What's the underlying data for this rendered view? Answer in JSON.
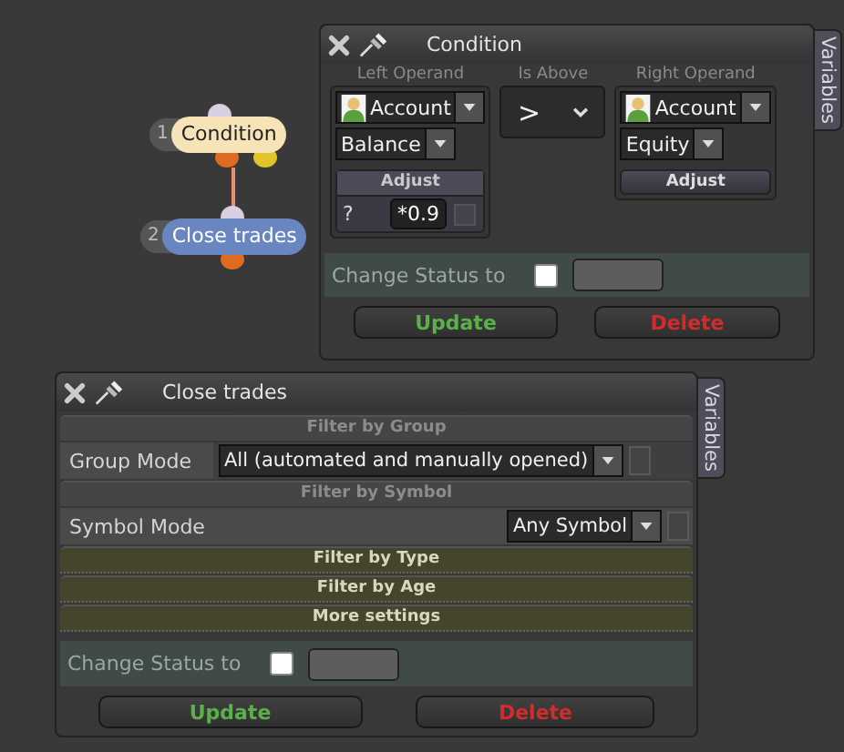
{
  "nodes": [
    {
      "number": "1",
      "label": "Condition",
      "color": "#f7e3b8",
      "has_branch": true
    },
    {
      "number": "2",
      "label": "Close trades",
      "color": "#6a86c0",
      "has_branch": false
    }
  ],
  "condition_window": {
    "title": "Condition",
    "tab": "Variables",
    "left_operand": {
      "label": "Left Operand",
      "source": "Account",
      "field": "Balance",
      "adjust": {
        "label": "Adjust",
        "prefix": "?",
        "value": "*0.9"
      }
    },
    "operator": {
      "label": "Is Above",
      "value": ">"
    },
    "right_operand": {
      "label": "Right Operand",
      "source": "Account",
      "field": "Equity",
      "adjust_button": "Adjust"
    },
    "change_status": {
      "label": "Change Status to",
      "checked": false
    },
    "buttons": [
      {
        "label": "Update",
        "kind": "update"
      },
      {
        "label": "Delete",
        "kind": "delete"
      }
    ]
  },
  "close_trades_window": {
    "title": "Close trades",
    "tab": "Variables",
    "sections": [
      {
        "title": "Filter by Group",
        "expanded": true,
        "rows": [
          {
            "label": "Group Mode",
            "value": "All (automated and manually opened)"
          }
        ]
      },
      {
        "title": "Filter by Symbol",
        "expanded": true,
        "rows": [
          {
            "label": "Symbol Mode",
            "value": "Any Symbol"
          }
        ]
      },
      {
        "title": "Filter by Type",
        "expanded": false
      },
      {
        "title": "Filter by Age",
        "expanded": false
      },
      {
        "title": "More settings",
        "expanded": false
      }
    ],
    "change_status": {
      "label": "Change Status to",
      "checked": false
    },
    "buttons": [
      {
        "label": "Update",
        "kind": "update"
      },
      {
        "label": "Delete",
        "kind": "delete"
      }
    ]
  }
}
